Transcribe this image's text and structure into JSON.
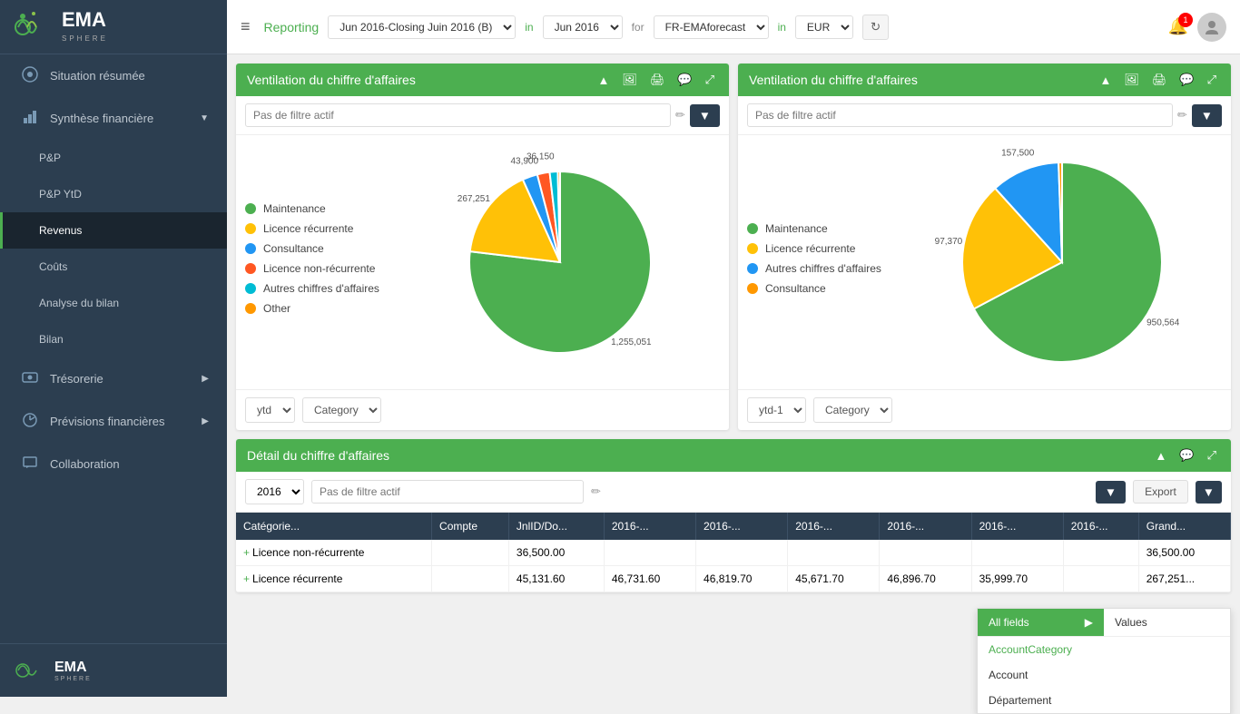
{
  "sidebar": {
    "logo": {
      "text": "EMA",
      "subtext": "SPHERE"
    },
    "items": [
      {
        "id": "situation",
        "label": "Situation résumée",
        "icon": "○",
        "hasArrow": false,
        "active": false
      },
      {
        "id": "synthese",
        "label": "Synthèse financière",
        "icon": "▦",
        "hasArrow": true,
        "active": false
      },
      {
        "id": "pp",
        "label": "P&P",
        "icon": "",
        "hasArrow": false,
        "active": false,
        "sub": true
      },
      {
        "id": "ppytd",
        "label": "P&P YtD",
        "icon": "",
        "hasArrow": false,
        "active": false,
        "sub": true
      },
      {
        "id": "revenus",
        "label": "Revenus",
        "icon": "",
        "hasArrow": false,
        "active": true,
        "sub": true
      },
      {
        "id": "couts",
        "label": "Coûts",
        "icon": "",
        "hasArrow": false,
        "active": false,
        "sub": true
      },
      {
        "id": "analyse",
        "label": "Analyse du bilan",
        "icon": "",
        "hasArrow": false,
        "active": false,
        "sub": true
      },
      {
        "id": "bilan",
        "label": "Bilan",
        "icon": "",
        "hasArrow": false,
        "active": false,
        "sub": true
      },
      {
        "id": "tresorerie",
        "label": "Trésorerie",
        "icon": "◻",
        "hasArrow": true,
        "active": false
      },
      {
        "id": "previsions",
        "label": "Prévisions financières",
        "icon": "◎",
        "hasArrow": true,
        "active": false
      },
      {
        "id": "collaboration",
        "label": "Collaboration",
        "icon": "☐",
        "hasArrow": false,
        "active": false
      }
    ]
  },
  "topbar": {
    "menu_icon": "≡",
    "reporting_label": "Reporting",
    "period_label": "Jun 2016-Closing Juin 2016 (B)",
    "in_label1": "in",
    "period2_label": "Jun 2016",
    "for_label": "for",
    "entity_label": "FR-EMAforecast",
    "in_label2": "in",
    "currency_label": "EUR",
    "notification_count": "1"
  },
  "panel1": {
    "title": "Ventilation du chiffre d'affaires",
    "filter_placeholder": "Pas de filtre actif",
    "legend": [
      {
        "label": "Maintenance",
        "color": "#4CAF50"
      },
      {
        "label": "Licence récurrente",
        "color": "#FFC107"
      },
      {
        "label": "Consultance",
        "color": "#2196F3"
      },
      {
        "label": "Licence non-récurrente",
        "color": "#FF5722"
      },
      {
        "label": "Autres chiffres d'affaires",
        "color": "#00BCD4"
      },
      {
        "label": "Other",
        "color": "#FF9800"
      }
    ],
    "pie_data": [
      {
        "label": "1,255,051",
        "value": 1255051,
        "color": "#4CAF50"
      },
      {
        "label": "267,251",
        "value": 267251,
        "color": "#FFC107"
      },
      {
        "label": "43,900",
        "value": 43900,
        "color": "#2196F3"
      },
      {
        "label": "36,150",
        "value": 36150,
        "color": "#FF5722"
      },
      {
        "label": "23,350",
        "value": 23350,
        "color": "#00BCD4"
      },
      {
        "label": "6,650",
        "value": 6650,
        "color": "#FF9800"
      }
    ],
    "footer": {
      "period_options": [
        "ytd"
      ],
      "period_selected": "ytd",
      "category_options": [
        "Category"
      ],
      "category_selected": "Category"
    }
  },
  "panel2": {
    "title": "Ventilation du chiffre d'affaires",
    "filter_placeholder": "Pas de filtre actif",
    "legend": [
      {
        "label": "Maintenance",
        "color": "#4CAF50"
      },
      {
        "label": "Licence récurrente",
        "color": "#FFC107"
      },
      {
        "label": "Autres chiffres d'affaires",
        "color": "#2196F3"
      },
      {
        "label": "Consultance",
        "color": "#FF9800"
      }
    ],
    "pie_data": [
      {
        "label": "950,564",
        "value": 950564,
        "color": "#4CAF50"
      },
      {
        "label": "297,370",
        "value": 297370,
        "color": "#FFC107"
      },
      {
        "label": "157,500",
        "value": 157500,
        "color": "#2196F3"
      },
      {
        "label": "8,000",
        "value": 8000,
        "color": "#FF9800"
      }
    ],
    "footer": {
      "period_selected": "ytd-1",
      "category_selected": "Category"
    }
  },
  "detail_panel": {
    "title": "Détail du chiffre d'affaires",
    "filter_placeholder": "Pas de filtre actif",
    "year": "2016",
    "export_label": "Export",
    "columns": [
      "Catégorie...",
      "Compte",
      "JnlID/Do...",
      "2016-...",
      "2016-...",
      "2016-...",
      "2016-...",
      "2016-...",
      "2016-...",
      "Grand..."
    ],
    "rows": [
      {
        "category": "Licence non-récurrente",
        "col3": "36,500.00",
        "grand": "36,500.00",
        "expand": true
      },
      {
        "category": "Licence récurrente",
        "col3": "45,131.60",
        "col4": "46,731.60",
        "col5": "46,819.70",
        "col6": "45,671.70",
        "col7": "46,896.70",
        "col8": "35,999.70",
        "grand": "267,251...",
        "expand": true
      }
    ],
    "dropdown": {
      "all_fields_label": "All fields",
      "values_label": "Values",
      "items": [
        "AccountCategory",
        "Account",
        "Département"
      ]
    }
  }
}
